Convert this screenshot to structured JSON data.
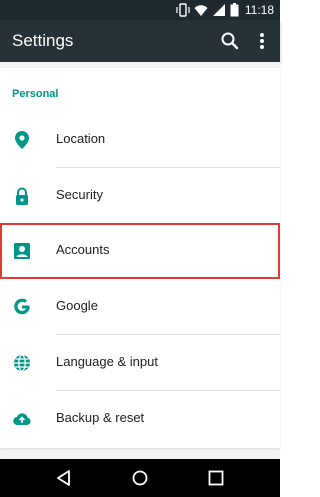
{
  "status_bar": {
    "time": "11:18",
    "icons": [
      "vibrate-icon",
      "wifi-icon",
      "signal-icon",
      "battery-icon"
    ]
  },
  "app_bar": {
    "title": "Settings",
    "actions": [
      "search-icon",
      "more-vert-icon"
    ]
  },
  "section": {
    "header": "Personal",
    "items": [
      {
        "label": "Location",
        "icon": "location-pin-icon"
      },
      {
        "label": "Security",
        "icon": "lock-icon"
      },
      {
        "label": "Accounts",
        "icon": "account-box-icon",
        "highlighted": true
      },
      {
        "label": "Google",
        "icon": "google-icon"
      },
      {
        "label": "Language & input",
        "icon": "globe-icon"
      },
      {
        "label": "Backup & reset",
        "icon": "cloud-upload-icon"
      }
    ]
  },
  "navigation": [
    "back-icon",
    "home-icon",
    "recents-icon"
  ],
  "colors": {
    "accent": "#009688",
    "app_bar": "#263238",
    "highlight": "#e53935"
  }
}
